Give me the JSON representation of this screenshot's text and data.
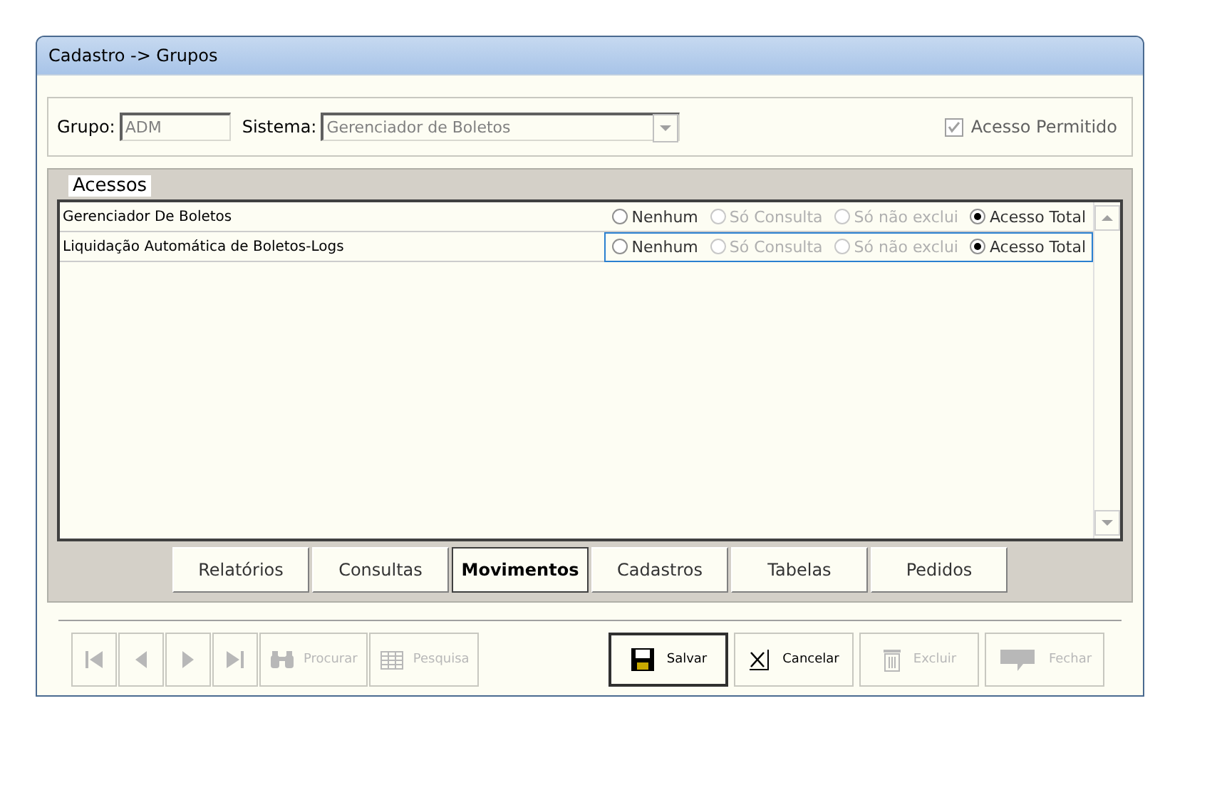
{
  "window": {
    "title": "Cadastro -> Grupos"
  },
  "header": {
    "grupo_label": "Grupo:",
    "grupo_value": "ADM",
    "sistema_label": "Sistema:",
    "sistema_value": "Gerenciador de Boletos",
    "acesso_permitido": {
      "label": "Acesso Permitido",
      "checked": true,
      "disabled": true
    }
  },
  "acessos": {
    "title": "Acessos",
    "rows": [
      {
        "name": "Gerenciador De Boletos",
        "selected": false,
        "options": [
          {
            "label": "Nenhum",
            "selected": false,
            "disabled": false
          },
          {
            "label": "Só Consulta",
            "selected": false,
            "disabled": true
          },
          {
            "label": "Só não exclui",
            "selected": false,
            "disabled": true
          },
          {
            "label": "Acesso Total",
            "selected": true,
            "disabled": false
          }
        ]
      },
      {
        "name": "Liquidação Automática de Boletos-Logs",
        "selected": true,
        "options": [
          {
            "label": "Nenhum",
            "selected": false,
            "disabled": false
          },
          {
            "label": "Só Consulta",
            "selected": false,
            "disabled": true
          },
          {
            "label": "Só não exclui",
            "selected": false,
            "disabled": true
          },
          {
            "label": "Acesso Total",
            "selected": true,
            "disabled": false
          }
        ]
      }
    ]
  },
  "tabs": [
    {
      "label": "Relatórios",
      "selected": false
    },
    {
      "label": "Consultas",
      "selected": false
    },
    {
      "label": "Movimentos",
      "selected": true
    },
    {
      "label": "Cadastros",
      "selected": false
    },
    {
      "label": "Tabelas",
      "selected": false
    },
    {
      "label": "Pedidos",
      "selected": false
    }
  ],
  "nav_buttons": [
    {
      "kind": "first",
      "disabled": true
    },
    {
      "kind": "prev",
      "disabled": true
    },
    {
      "kind": "next",
      "disabled": true
    },
    {
      "kind": "last",
      "disabled": true
    }
  ],
  "search_buttons": [
    {
      "kind": "binoculars",
      "label": "Procurar",
      "disabled": true
    },
    {
      "kind": "grid",
      "label": "Pesquisa",
      "disabled": true
    }
  ],
  "action_buttons": [
    {
      "kind": "save",
      "label": "Salvar",
      "disabled": false
    },
    {
      "kind": "cancel",
      "label": "Cancelar",
      "disabled": false
    },
    {
      "kind": "trash",
      "label": "Excluir",
      "disabled": true
    },
    {
      "kind": "close",
      "label": "Fechar",
      "disabled": true
    }
  ]
}
